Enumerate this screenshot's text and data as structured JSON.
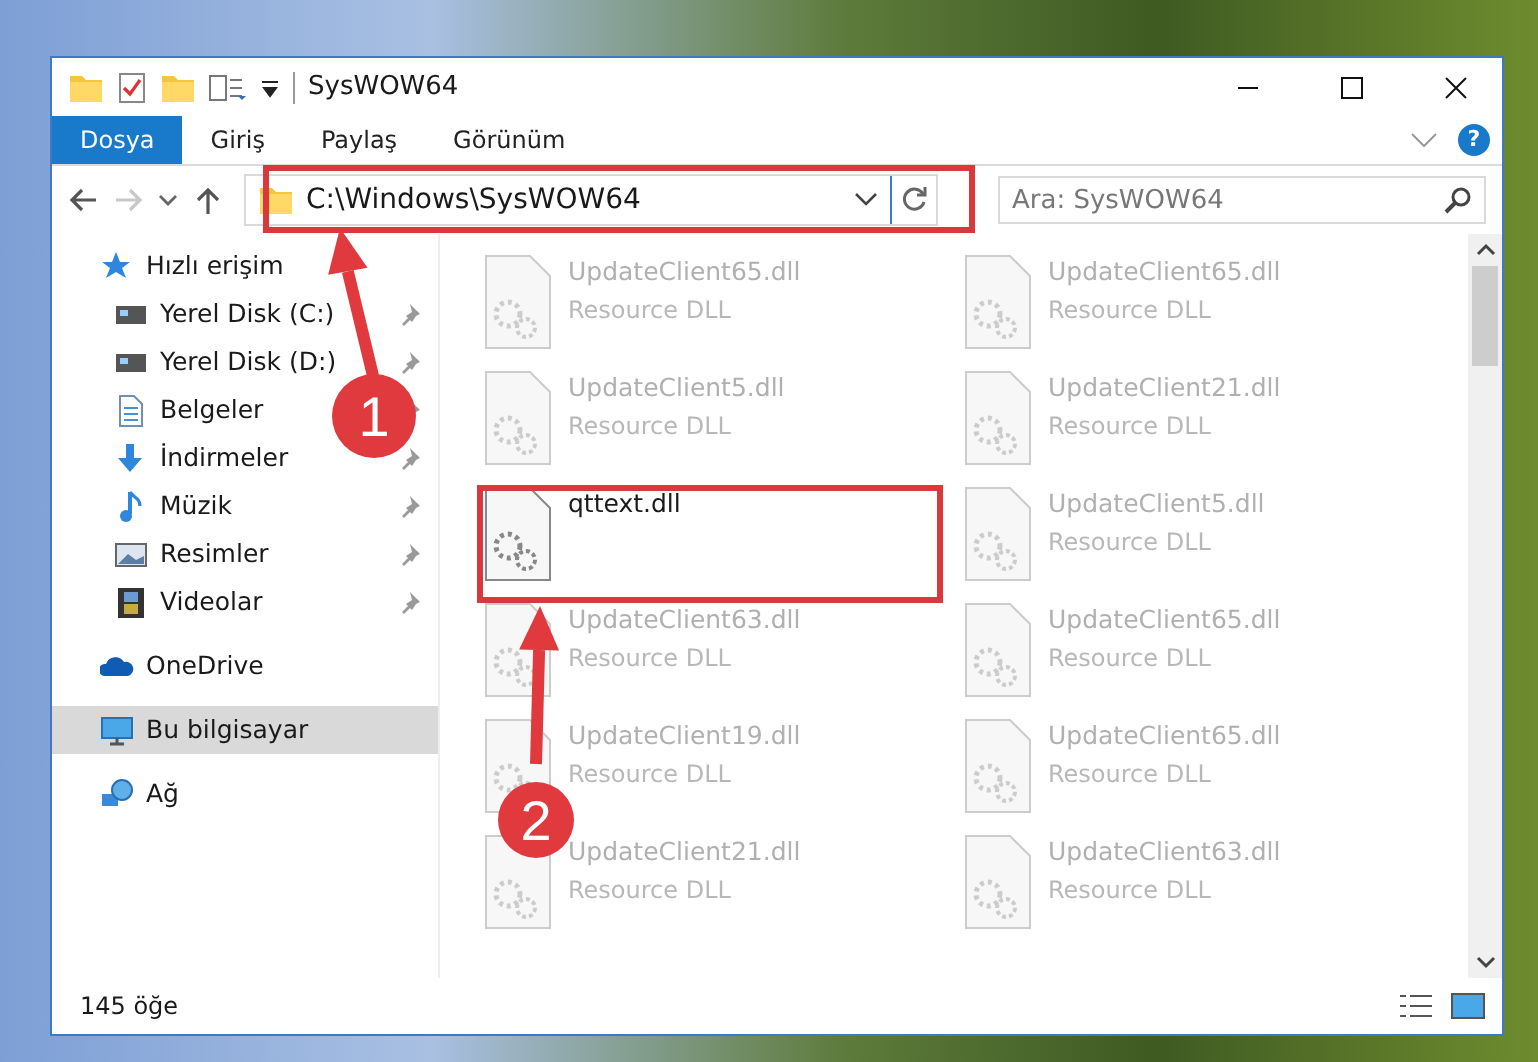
{
  "window": {
    "title": "SysWOW64"
  },
  "ribbon": {
    "tabs": [
      {
        "label": "Dosya",
        "selected": true
      },
      {
        "label": "Giriş",
        "selected": false
      },
      {
        "label": "Paylaş",
        "selected": false
      },
      {
        "label": "Görünüm",
        "selected": false
      }
    ],
    "help": "?"
  },
  "address_bar": {
    "path": "C:\\Windows\\SysWOW64",
    "forward_disabled": true
  },
  "search": {
    "placeholder": "Ara: SysWOW64"
  },
  "sidebar": {
    "items": [
      {
        "label": "Hızlı erişim",
        "selected": false,
        "children": [
          {
            "label": "Yerel Disk (C:)",
            "pinned": true,
            "selected": false
          },
          {
            "label": "Yerel Disk (D:)",
            "pinned": true,
            "selected": false
          },
          {
            "label": "Belgeler",
            "pinned": true,
            "selected": false
          },
          {
            "label": "İndirmeler",
            "pinned": true,
            "selected": false
          },
          {
            "label": "Müzik",
            "pinned": true,
            "selected": false
          },
          {
            "label": "Resimler",
            "pinned": true,
            "selected": false
          },
          {
            "label": "Videolar",
            "pinned": true,
            "selected": false
          }
        ]
      },
      {
        "label": "OneDrive",
        "selected": false
      },
      {
        "label": "Bu bilgisayar",
        "selected": true
      },
      {
        "label": "Ağ",
        "selected": false
      }
    ]
  },
  "files": [
    {
      "name": "UpdateClient65.dll",
      "type": "Resource DLL",
      "dimmed": true
    },
    {
      "name": "UpdateClient65.dll",
      "type": "Resource DLL",
      "dimmed": true
    },
    {
      "name": "UpdateClient5.dll",
      "type": "Resource DLL",
      "dimmed": true
    },
    {
      "name": "UpdateClient21.dll",
      "type": "Resource DLL",
      "dimmed": true
    },
    {
      "name": "qttext.dll",
      "dimmed": false,
      "highlighted": true
    },
    {
      "name": "UpdateClient5.dll",
      "type": "Resource DLL",
      "dimmed": true
    },
    {
      "name": "UpdateClient63.dll",
      "type": "Resource DLL",
      "dimmed": true
    },
    {
      "name": "UpdateClient65.dll",
      "type": "Resource DLL",
      "dimmed": true
    },
    {
      "name": "UpdateClient19.dll",
      "type": "Resource DLL",
      "dimmed": true
    },
    {
      "name": "UpdateClient65.dll",
      "type": "Resource DLL",
      "dimmed": true
    },
    {
      "name": "UpdateClient21.dll",
      "type": "Resource DLL",
      "dimmed": true
    },
    {
      "name": "UpdateClient63.dll",
      "type": "Resource DLL",
      "dimmed": true
    }
  ],
  "status_bar": {
    "count": "145 öğe"
  },
  "annotations": [
    {
      "label": "1"
    },
    {
      "label": "2"
    }
  ]
}
